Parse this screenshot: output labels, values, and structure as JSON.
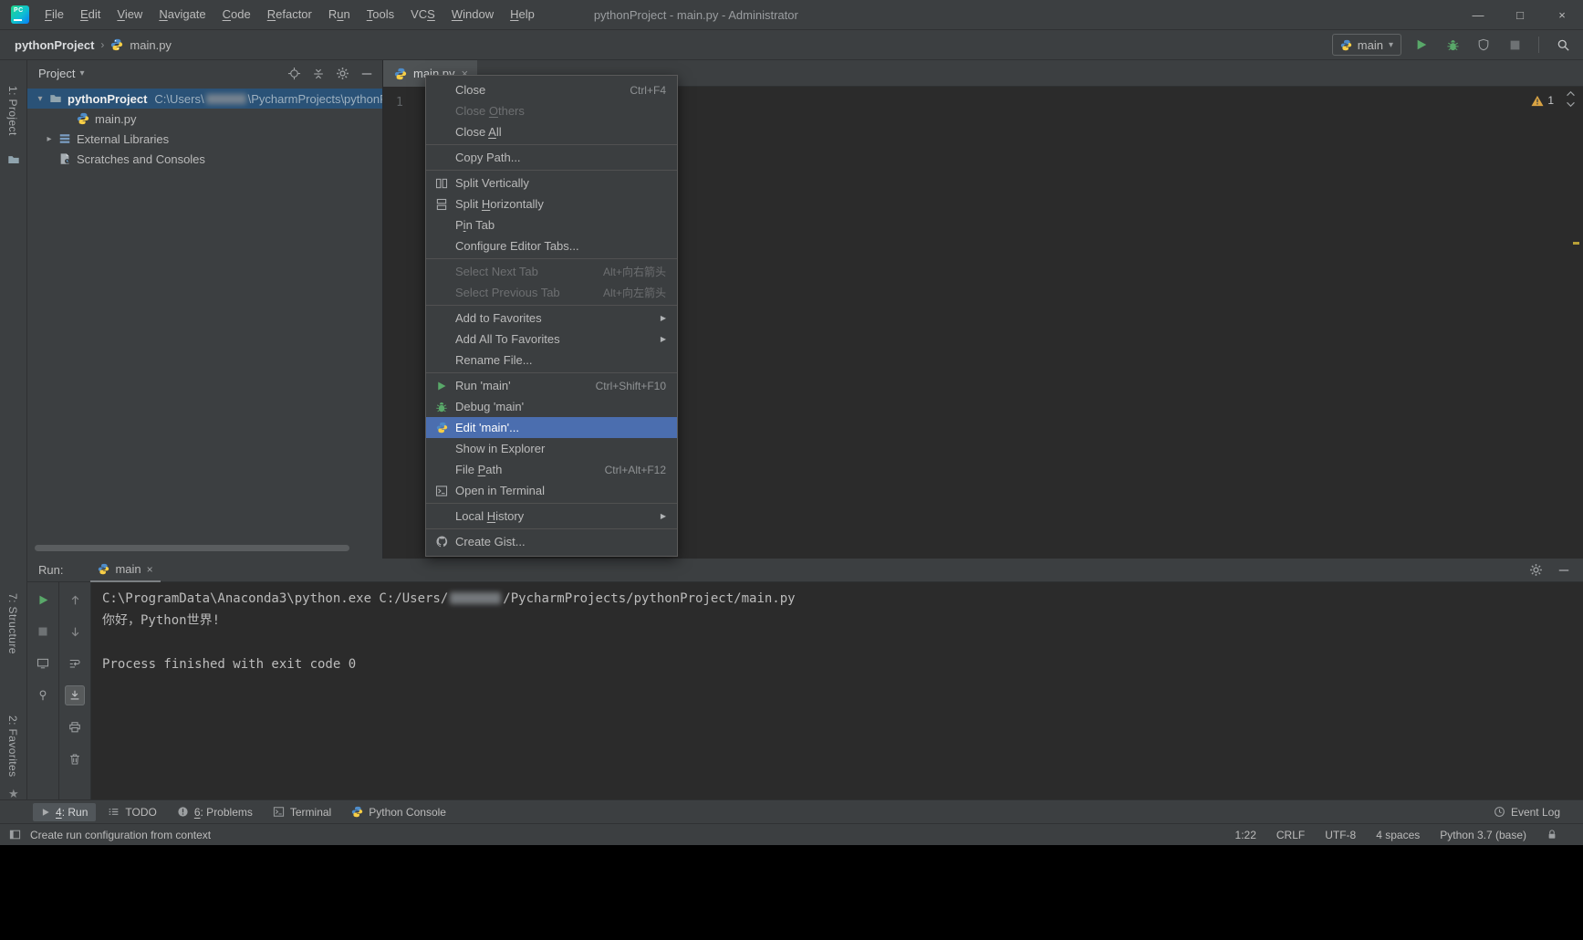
{
  "glyphs": {
    "caret_down": "▾",
    "tree_expanded": "▾",
    "tree_collapsed": "▸",
    "breadcrumb_sep": "›",
    "close": "×",
    "minimize": "—",
    "maximize": "□",
    "submenu_arrow": "▶",
    "star": "★"
  },
  "title_bar": {
    "logo_text": "PC",
    "menus": [
      {
        "label": "File",
        "u": "F"
      },
      {
        "label": "Edit",
        "u": "E"
      },
      {
        "label": "View",
        "u": "V"
      },
      {
        "label": "Navigate",
        "u": "N"
      },
      {
        "label": "Code",
        "u": "C"
      },
      {
        "label": "Refactor",
        "u": "R"
      },
      {
        "label": "Run",
        "u": "u"
      },
      {
        "label": "Tools",
        "u": "T"
      },
      {
        "label": "VCS",
        "u": "S"
      },
      {
        "label": "Window",
        "u": "W"
      },
      {
        "label": "Help",
        "u": "H"
      }
    ],
    "title": "pythonProject - main.py - Administrator"
  },
  "navbar": {
    "breadcrumb_project": "pythonProject",
    "breadcrumb_file": "main.py",
    "run_config": "main"
  },
  "left_strip": {
    "project": "1: Project",
    "structure": "7: Structure",
    "favorites": "2: Favorites"
  },
  "project_panel": {
    "title": "Project",
    "root_name": "pythonProject",
    "root_path_prefix": "C:\\Users\\",
    "root_path_suffix": "\\PycharmProjects\\pythonP",
    "file": "main.py",
    "external_libraries": "External Libraries",
    "scratches": "Scratches and Consoles"
  },
  "editor": {
    "tab": "main.py",
    "line_number": "1",
    "warning_count": "1"
  },
  "context_menu": {
    "items": [
      {
        "label": "Close",
        "shortcut": "Ctrl+F4"
      },
      {
        "label": "Close Others",
        "u": "O",
        "disabled": true
      },
      {
        "label": "Close All",
        "u": "A"
      },
      {
        "label": "Copy Path..."
      },
      {
        "label": "Split Vertically"
      },
      {
        "label": "Split Horizontally",
        "u": "H"
      },
      {
        "label": "Pin Tab",
        "u": "i"
      },
      {
        "label": "Configure Editor Tabs..."
      },
      {
        "label": "Select Next Tab",
        "shortcut": "Alt+向右箭头",
        "disabled": true
      },
      {
        "label": "Select Previous Tab",
        "shortcut": "Alt+向左箭头",
        "disabled": true
      },
      {
        "label": "Add to Favorites",
        "submenu": true
      },
      {
        "label": "Add All To Favorites",
        "submenu": true
      },
      {
        "label": "Rename File..."
      },
      {
        "label": "Run 'main'",
        "shortcut": "Ctrl+Shift+F10"
      },
      {
        "label": "Debug 'main'"
      },
      {
        "label": "Edit 'main'...",
        "selected": true
      },
      {
        "label": "Show in Explorer"
      },
      {
        "label": "File Path",
        "shortcut": "Ctrl+Alt+F12",
        "u": "P"
      },
      {
        "label": "Open in Terminal"
      },
      {
        "label": "Local History",
        "u": "H",
        "submenu": true
      },
      {
        "label": "Create Gist..."
      }
    ]
  },
  "run_panel": {
    "label": "Run:",
    "tab": "main",
    "console": {
      "cmd_prefix": "C:\\ProgramData\\Anaconda3\\python.exe C:/Users/",
      "cmd_suffix": "/PycharmProjects/pythonProject/main.py",
      "output_line": "你好，Python世界!",
      "exit_line": "Process finished with exit code 0"
    }
  },
  "toolwindow_bar": {
    "run": {
      "label": "4: Run",
      "u": "4"
    },
    "todo": {
      "label": "TODO"
    },
    "problems": {
      "label": "6: Problems",
      "u": "6"
    },
    "terminal": {
      "label": "Terminal"
    },
    "python_console": {
      "label": "Python Console"
    },
    "event_log": {
      "label": "Event Log"
    }
  },
  "status_bar": {
    "message": "Create run configuration from context",
    "caret": "1:22",
    "line_sep": "CRLF",
    "encoding": "UTF-8",
    "indent": "4 spaces",
    "interpreter": "Python 3.7 (base)"
  }
}
